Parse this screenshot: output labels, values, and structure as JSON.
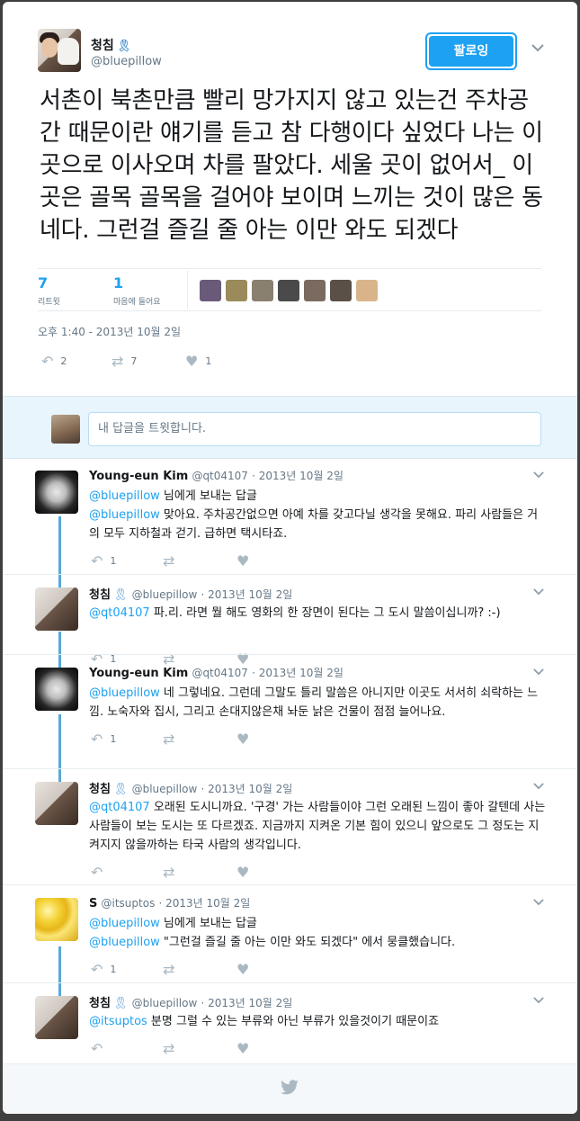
{
  "main_tweet": {
    "author_name": "청침",
    "ribbon_icon": "blue-ribbon-icon",
    "handle": "@bluepillow",
    "follow_label": "팔로잉",
    "text": "서촌이 북촌만큼 빨리 망가지지 않고 있는건 주차공간 때문이란 얘기를 듣고 참 다행이다 싶었다 나는 이곳으로 이사오며 차를 팔았다. 세울 곳이 없어서_ 이 곳은 골목 골목을 걸어야 보이며 느끼는 것이 많은 동네다. 그런걸 즐길 줄 아는 이만 와도 되겠다",
    "retweets_count": "7",
    "retweets_label": "리트윗",
    "likes_count": "1",
    "likes_label": "마음에 들어요",
    "timestamp": "오후 1:40 - 2013년 10월 2일",
    "action_reply_count": "2",
    "action_retweet_count": "7",
    "action_like_count": "1",
    "liker_colors": [
      "#6a5a7a",
      "#9b8a5a",
      "#8a8070",
      "#4a4a4a",
      "#7a6a60",
      "#5a5048",
      "#d9b48a"
    ]
  },
  "reply_box": {
    "placeholder": "내 답글을 트윗합니다."
  },
  "replies": [
    {
      "name": "Young-eun Kim",
      "handle": "@qt04107",
      "date": "· 2013년 10월 2일",
      "reply_to_mention": "@bluepillow",
      "reply_to_text": " 님에게 보내는 답글",
      "mention": "@bluepillow",
      "text": " 맞아요. 주차공간없으면 아예 차를 갖고다닐 생각을 못해요. 파리 사람들은 거의 모두 지하철과 걷기. 급하면 택시타죠.",
      "reply_count": "1",
      "retweet_count": "",
      "like_count": ""
    },
    {
      "name": "청침",
      "handle": "@bluepillow",
      "date": "· 2013년 10월 2일",
      "mention": "@qt04107",
      "text": " 파.리. 라면 뭘 해도 영화의 한 장면이 된다는 그 도시 말씀이십니까? :-)",
      "reply_count": "1",
      "retweet_count": "",
      "like_count": ""
    },
    {
      "name": "Young-eun Kim",
      "handle": "@qt04107",
      "date": "· 2013년 10월 2일",
      "mention": "@bluepillow",
      "text": " 네 그렇네요. 그런데 그말도 틀리 말씀은 아니지만 이곳도 서서히 쇠락하는 느낌. 노숙자와 집시, 그리고 손대지않은채 놔둔 낡은 건물이 점점 늘어나요.",
      "reply_count": "1",
      "retweet_count": "",
      "like_count": ""
    },
    {
      "name": "청침",
      "handle": "@bluepillow",
      "date": "· 2013년 10월 2일",
      "mention": "@qt04107",
      "text": " 오래된 도시니까요. '구경' 가는 사람들이야 그런 오래된 느낌이 좋아 갈텐데 사는 사람들이 보는 도시는 또 다르겠죠. 지금까지 지켜온 기본 힘이 있으니 앞으로도 그 정도는 지켜지지 않을까하는 타국 사람의 생각입니다.",
      "reply_count": "",
      "retweet_count": "",
      "like_count": ""
    },
    {
      "name": "S",
      "handle": "@itsuptos",
      "date": "· 2013년 10월 2일",
      "reply_to_mention": "@bluepillow",
      "reply_to_text": " 님에게 보내는 답글",
      "mention": "@bluepillow",
      "text": " \"그런걸 즐길 줄 아는 이만 와도 되겠다\" 에서 뭉클했습니다.",
      "reply_count": "1",
      "retweet_count": "",
      "like_count": ""
    },
    {
      "name": "청침",
      "handle": "@bluepillow",
      "date": "· 2013년 10월 2일",
      "mention": "@itsuptos",
      "text": " 분명 그럴 수 있는 부류와 아닌 부류가 있을것이기 때문이죠",
      "reply_count": "",
      "retweet_count": "",
      "like_count": ""
    }
  ],
  "footer": {
    "icon": "twitter-bird-icon"
  },
  "colors": {
    "accent": "#1da1f2",
    "thread_line": "#57a9d6",
    "muted": "#657786"
  }
}
